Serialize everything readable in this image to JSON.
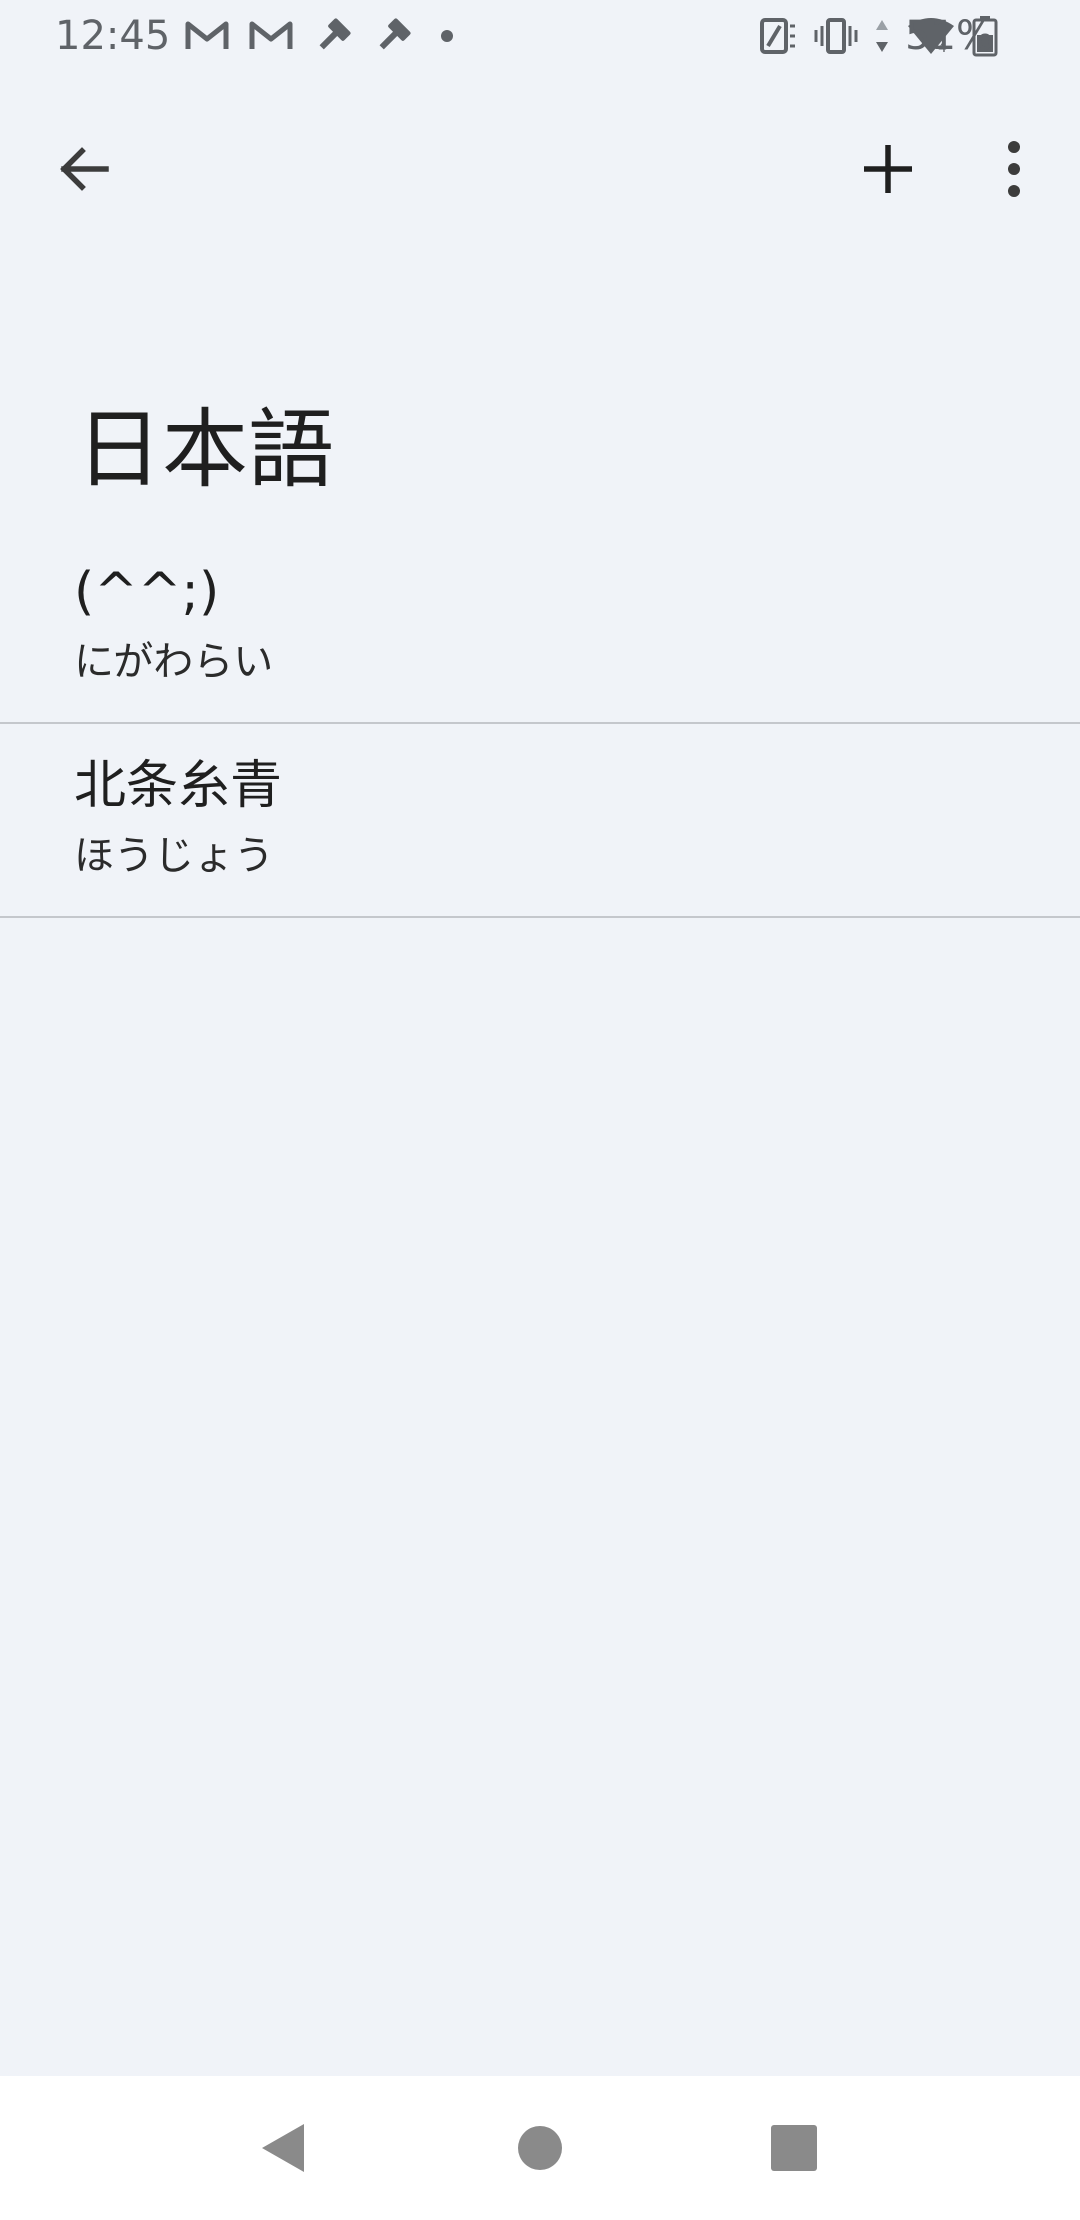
{
  "status_bar": {
    "time": "12:45",
    "left_icons": [
      "gmail-icon",
      "gmail-icon",
      "gavel-icon",
      "gavel-icon",
      "dot-icon"
    ],
    "right_icons": [
      "rotate-icon",
      "vibrate-icon",
      "data-arrows-icon",
      "wifi-icon",
      "battery-icon"
    ],
    "battery_percent": "51%"
  },
  "app_bar": {
    "back_icon": "arrow-back-icon",
    "add_icon": "plus-icon",
    "more_icon": "more-vert-icon"
  },
  "page": {
    "title": "日本語"
  },
  "entries": [
    {
      "word": "(^^;)",
      "reading": "にがわらい"
    },
    {
      "word": "北条糸青",
      "reading": "ほうじょう"
    }
  ],
  "nav_bar": {
    "back_icon": "nav-back-icon",
    "home_icon": "nav-home-icon",
    "recents_icon": "nav-recents-icon"
  },
  "colors": {
    "background": "#f0f3f8",
    "text": "#1f1f1f",
    "divider": "#c4c7cc",
    "status": "#5f6368",
    "nav_icons": "#8a8a8a"
  }
}
